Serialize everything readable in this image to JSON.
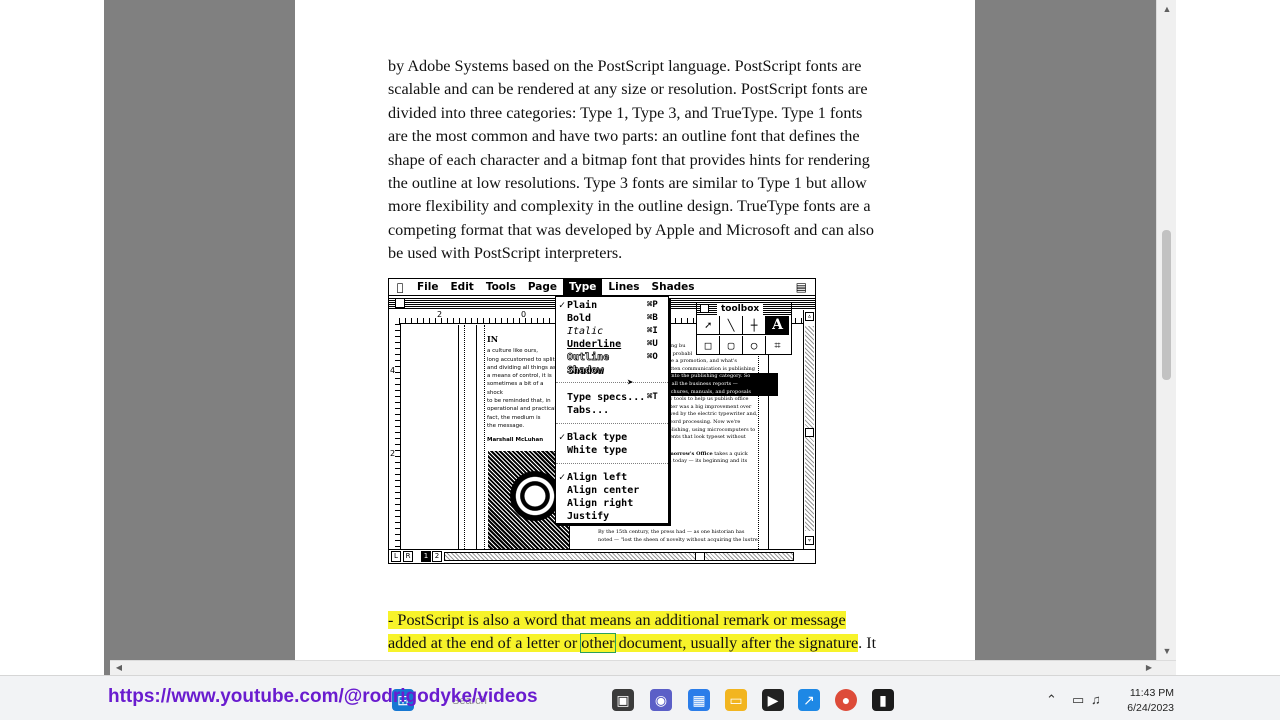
{
  "article": {
    "paragraph1": [
      "by Adobe Systems based on the PostScript language. PostScript fonts are",
      "scalable and can be rendered at any size or resolution. PostScript fonts are",
      "divided into three categories: Type 1, Type 3, and TrueType. Type 1 fonts",
      "are the most common and have two parts: an outline font that defines the",
      "shape of each character and a bitmap font that provides hints for rendering",
      "the outline at low resolutions. Type 3 fonts are similar to Type 1 but allow",
      "more flexibility and complexity in the outline design. TrueType fonts are a",
      "competing format that was developed by Apple and Microsoft and can also",
      "be used with PostScript interpreters."
    ],
    "paragraph2": {
      "line1_highlighted": "- PostScript is also a word that means an additional remark or message",
      "line2_before": "added at the end of a letter or ",
      "line2_boxed": "other",
      "line2_after_highlighted": " document, usually after the signature",
      "line2_tail": ". It"
    }
  },
  "mac_screenshot": {
    "menubar": {
      "apple": "",
      "items": [
        "File",
        "Edit",
        "Tools",
        "Page",
        "Type",
        "Lines",
        "Shades"
      ],
      "active": "Type"
    },
    "ruler_numbers": {
      "h": [
        "2",
        "0"
      ],
      "v": [
        "4",
        "2"
      ]
    },
    "type_menu": {
      "items": [
        {
          "label": "Plain",
          "key": "⌘P",
          "checked": true
        },
        {
          "label": "Bold",
          "key": "⌘B",
          "checked": false
        },
        {
          "label": "Italic",
          "key": "⌘I",
          "checked": false
        },
        {
          "label": "Underline",
          "key": "⌘U",
          "checked": false
        },
        {
          "label": "Outline",
          "key": "⌘O",
          "checked": false
        },
        {
          "label": "Shadow",
          "key": "",
          "checked": false
        },
        {
          "label": "Type specs...",
          "key": "⌘T",
          "checked": false
        },
        {
          "label": "Tabs...",
          "key": "",
          "checked": false
        },
        {
          "label": "Black type",
          "key": "",
          "checked": true
        },
        {
          "label": "White type",
          "key": "",
          "checked": false
        },
        {
          "label": "Align left",
          "key": "",
          "checked": true
        },
        {
          "label": "Align center",
          "key": "",
          "checked": false
        },
        {
          "label": "Align right",
          "key": "",
          "checked": false
        },
        {
          "label": "Justify",
          "key": "",
          "checked": false
        }
      ]
    },
    "toolbox": {
      "title": "toolbox",
      "text_tool": "A"
    },
    "column1": {
      "head": "IN",
      "lines": [
        "a culture like ours,",
        "long accustomed to split",
        "and dividing all things as",
        "a means of control, it is",
        "sometimes a bit of a shock",
        "to be reminded that, in",
        "operational and practical",
        "fact, the medium is",
        "the message."
      ],
      "signature": "Marshall McLuhan"
    },
    "column2": {
      "lines": [
        "ishing bu",
        "you probabl",
        "gave a promotion, and what's",
        "written communication is publishing",
        "all into the publishing category. So",
        "ing all the business reports —",
        "brochures, manuals, and proposals",
        "new tools to help us publish office",
        "writer was a big improvement over",
        "llowed by the electric typewriter and,",
        "ly word processing. Now we're",
        "publishing, using microcomputers to",
        "uments that look typeset without"
      ],
      "bold_lead": "Tomorrow's Office",
      "bold_tail": "takes a quick",
      "last": "and today — its beginning and its"
    },
    "column3": [
      "By the 15th century, the press had — as one historian has",
      "noted — \"lost the sheen of novelty without acquiring the lustre"
    ],
    "page_tabs": [
      "L",
      "R",
      "1",
      "2"
    ],
    "page_active": "1"
  },
  "taskbar": {
    "url_overlay": "https://www.youtube.com/@rodrigodyke/videos",
    "search_text": "Search",
    "clock_time": "11:43 PM",
    "clock_date": "6/24/2023"
  }
}
